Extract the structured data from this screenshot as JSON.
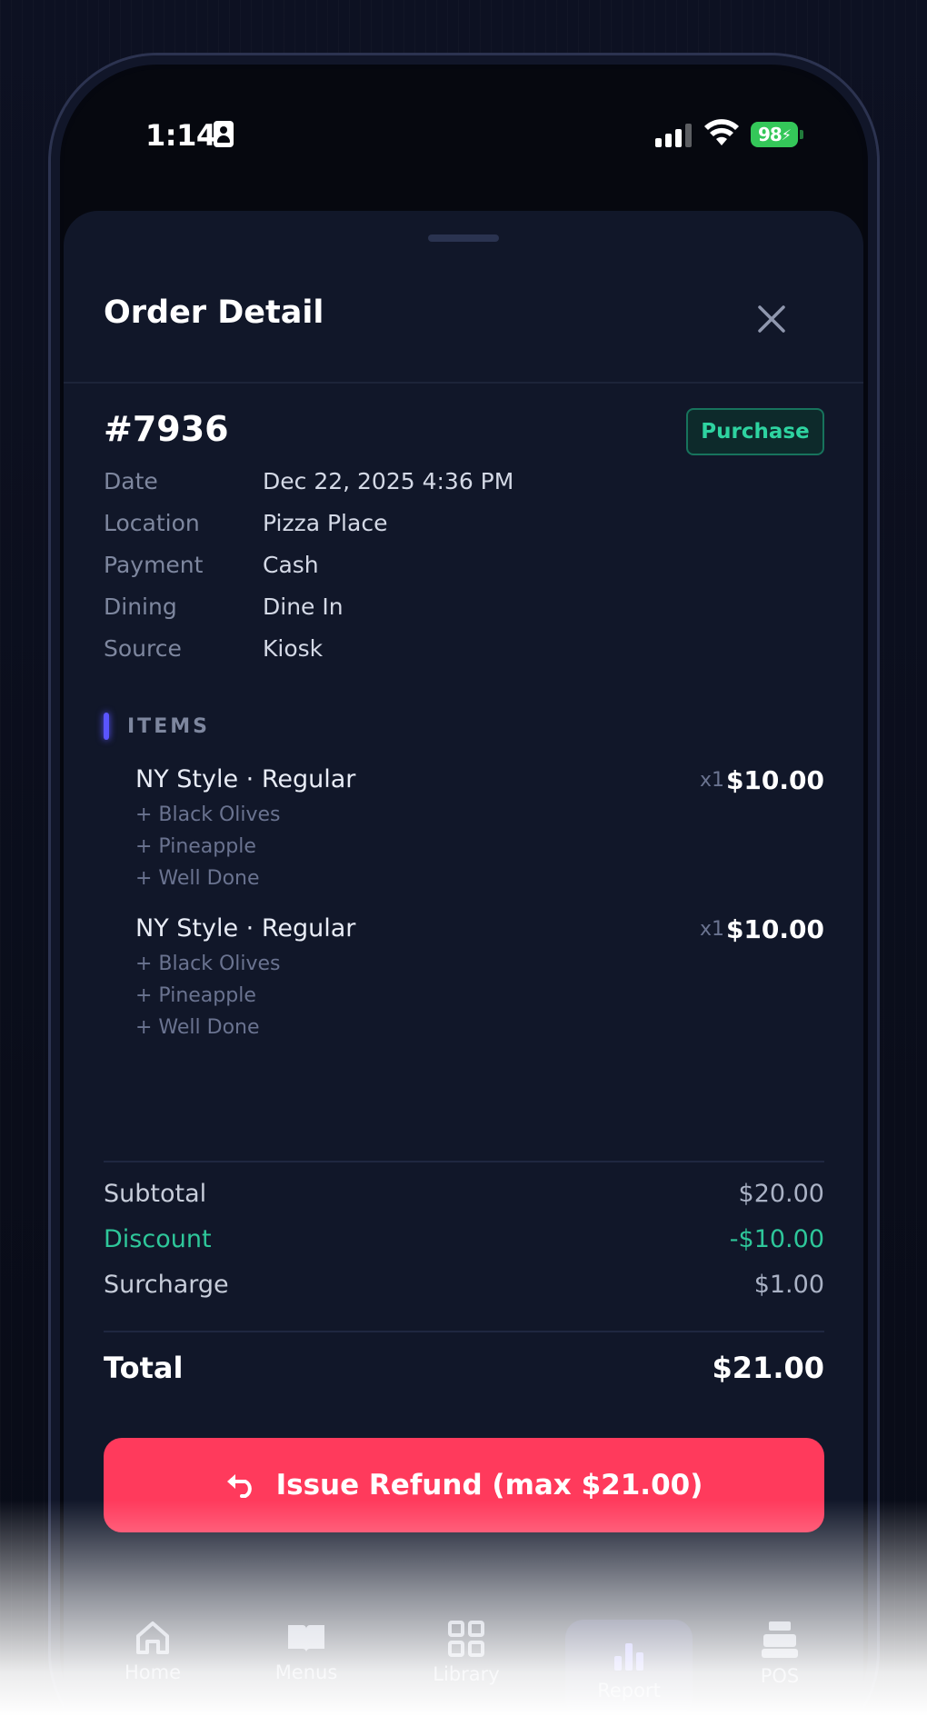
{
  "status_bar": {
    "time": "1:14",
    "battery": "98"
  },
  "sheet": {
    "title": "Order Detail"
  },
  "order": {
    "number": "#7936",
    "type_badge": "Purchase",
    "meta": [
      {
        "label": "Date",
        "value": "Dec 22, 2025 4:36 PM"
      },
      {
        "label": "Location",
        "value": "Pizza Place"
      },
      {
        "label": "Payment",
        "value": "Cash"
      },
      {
        "label": "Dining",
        "value": "Dine In"
      },
      {
        "label": "Source",
        "value": "Kiosk"
      }
    ]
  },
  "items_section": {
    "label": "ITEMS",
    "items": [
      {
        "name": "NY Style · Regular",
        "qty": "x1",
        "price": "$10.00",
        "modifiers": [
          "+ Black Olives",
          "+ Pineapple",
          "+ Well Done"
        ]
      },
      {
        "name": "NY Style · Regular",
        "qty": "x1",
        "price": "$10.00",
        "modifiers": [
          "+ Black Olives",
          "+ Pineapple",
          "+ Well Done"
        ]
      }
    ]
  },
  "totals": {
    "subtotal_label": "Subtotal",
    "subtotal": "$20.00",
    "discount_label": "Discount",
    "discount": "-$10.00",
    "surcharge_label": "Surcharge",
    "surcharge": "$1.00",
    "total_label": "Total",
    "total": "$21.00"
  },
  "refund_button": {
    "label": "Issue Refund (max $21.00)"
  },
  "tabbar": {
    "tabs": [
      {
        "label": "Home",
        "icon": "home-icon"
      },
      {
        "label": "Menus",
        "icon": "book-icon"
      },
      {
        "label": "Library",
        "icon": "grid-icon"
      },
      {
        "label": "Report",
        "icon": "bar-chart-icon",
        "active": true
      },
      {
        "label": "POS",
        "icon": "register-icon"
      }
    ]
  },
  "colors": {
    "accent": "#5a55ff",
    "refund": "#ff3a5c",
    "discount": "#2ec79a",
    "badge_text": "#2ed3a0"
  }
}
